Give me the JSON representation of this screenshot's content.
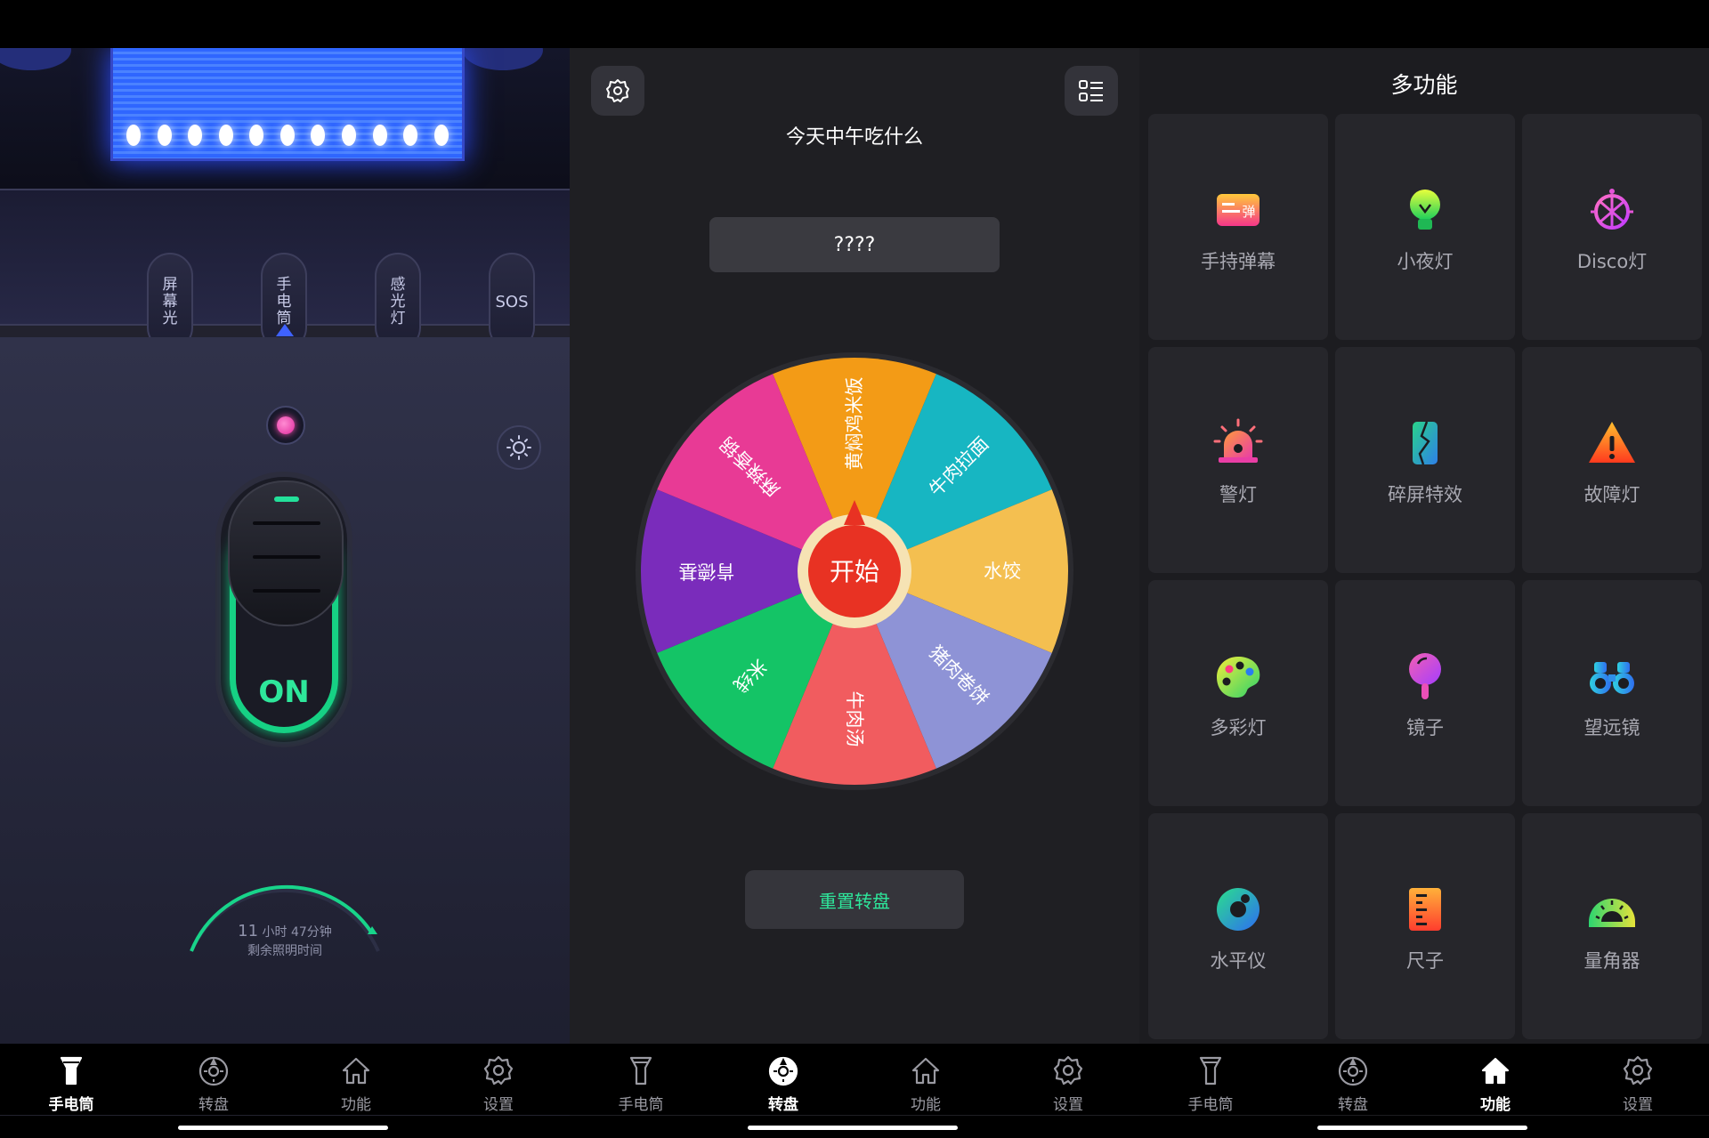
{
  "flashlight": {
    "modes": [
      {
        "label": "屏幕光"
      },
      {
        "label": "手电筒"
      },
      {
        "label": "感光灯"
      },
      {
        "label": "SOS"
      }
    ],
    "switch_label": "ON",
    "remaining_hours": "11",
    "remaining_hours_unit": "小时",
    "remaining_minutes": "47分钟",
    "remaining_caption": "剩余照明时间"
  },
  "wheel": {
    "title": "今天中午吃什么",
    "result": "????",
    "start_label": "开始",
    "reset_label": "重置转盘",
    "segments": [
      {
        "label": "黄焖鸡米饭",
        "color": "#f39b16"
      },
      {
        "label": "牛肉拉面",
        "color": "#17b6c2"
      },
      {
        "label": "水饺",
        "color": "#f4bf50"
      },
      {
        "label": "猪肉卷饼",
        "color": "#8e93d6"
      },
      {
        "label": "牛肉汤",
        "color": "#f15c5f"
      },
      {
        "label": "米线",
        "color": "#14c466"
      },
      {
        "label": "肯德基",
        "color": "#7a2cbb"
      },
      {
        "label": "麻辣香锅",
        "color": "#e83a95"
      }
    ]
  },
  "features": {
    "title": "多功能",
    "items": [
      {
        "label": "手持弹幕",
        "icon": "barrage-icon"
      },
      {
        "label": "小夜灯",
        "icon": "bulb-icon"
      },
      {
        "label": "Disco灯",
        "icon": "disco-ball-icon"
      },
      {
        "label": "警灯",
        "icon": "siren-icon"
      },
      {
        "label": "碎屏特效",
        "icon": "broken-screen-icon"
      },
      {
        "label": "故障灯",
        "icon": "warning-icon"
      },
      {
        "label": "多彩灯",
        "icon": "palette-icon"
      },
      {
        "label": "镜子",
        "icon": "mirror-icon"
      },
      {
        "label": "望远镜",
        "icon": "binoculars-icon"
      },
      {
        "label": "水平仪",
        "icon": "level-icon"
      },
      {
        "label": "尺子",
        "icon": "ruler-icon"
      },
      {
        "label": "量角器",
        "icon": "protractor-icon"
      }
    ]
  },
  "nav": {
    "items": [
      {
        "label": "手电筒",
        "icon": "flashlight-icon"
      },
      {
        "label": "转盘",
        "icon": "wheel-icon"
      },
      {
        "label": "功能",
        "icon": "home-icon"
      },
      {
        "label": "设置",
        "icon": "gear-icon"
      }
    ],
    "active": [
      "手电筒",
      "转盘",
      "功能"
    ]
  }
}
